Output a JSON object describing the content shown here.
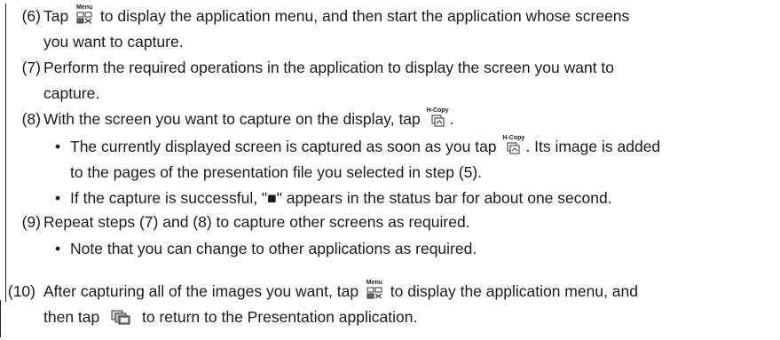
{
  "steps": [
    {
      "num": "(6)",
      "lines": [
        {
          "pre": "Tap ",
          "icon": "menu",
          "post": " to display the application menu, and then start the application whose screens"
        },
        {
          "pre": "you want to capture."
        }
      ]
    },
    {
      "num": "(7)",
      "lines": [
        {
          "pre": "Perform the required operations in the application to display the screen you want to"
        },
        {
          "pre": "capture."
        }
      ]
    },
    {
      "num": "(8)",
      "lines": [
        {
          "pre": "With the screen you want to capture on the display, tap ",
          "icon": "hcopy",
          "post": "."
        }
      ],
      "bullets": [
        {
          "lines": [
            {
              "pre": "The currently displayed screen is captured as soon as you tap ",
              "icon": "hcopy",
              "post": ". Its image is added"
            },
            {
              "pre": "to the pages of the presentation file you selected in step (5)."
            }
          ]
        },
        {
          "lines": [
            {
              "pre": "If the capture is successful, \"■\" appears in the status bar for about one second."
            }
          ]
        }
      ]
    },
    {
      "num": "(9)",
      "lines": [
        {
          "pre": "Repeat steps (7) and (8) to capture other screens as required."
        }
      ],
      "bullets": [
        {
          "lines": [
            {
              "pre": "Note that you can change to other applications as required."
            }
          ]
        }
      ]
    },
    {
      "num": "(10)",
      "lines": [
        {
          "pre": "After capturing all of the images you want, tap ",
          "icon": "menu",
          "post": " to display the application menu, and"
        },
        {
          "pre": "then tap ",
          "icon": "presentation",
          "post": " to return to the Presentation application."
        }
      ]
    }
  ],
  "icons": {
    "menu": {
      "name": "menu-icon",
      "caption": "Menu"
    },
    "hcopy": {
      "name": "h-copy-icon",
      "caption": "H-Copy"
    },
    "presentation": {
      "name": "presentation-icon"
    }
  },
  "colors": {
    "text": "#1a1a1a",
    "rule": "#222222"
  }
}
